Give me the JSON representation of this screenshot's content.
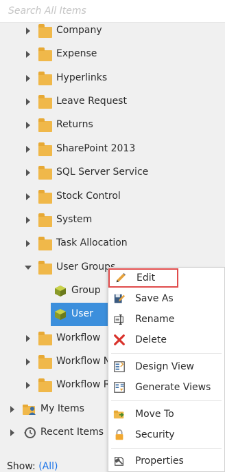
{
  "search": {
    "placeholder": "Search All Items"
  },
  "tree": {
    "folders": [
      {
        "label": "Company"
      },
      {
        "label": "Expense"
      },
      {
        "label": "Hyperlinks"
      },
      {
        "label": "Leave Request"
      },
      {
        "label": "Returns"
      },
      {
        "label": "SharePoint 2013"
      },
      {
        "label": "SQL Server Service"
      },
      {
        "label": "Stock Control"
      },
      {
        "label": "System"
      },
      {
        "label": "Task Allocation"
      },
      {
        "label": "User Groups"
      }
    ],
    "user_groups_children": [
      {
        "label": "Group"
      },
      {
        "label": "User"
      }
    ],
    "workflow_folders": [
      {
        "label": "Workflow"
      },
      {
        "label": "Workflow N"
      },
      {
        "label": "Workflow R"
      }
    ],
    "top_level": [
      {
        "label": "My Items"
      },
      {
        "label": "Recent Items"
      }
    ]
  },
  "context_menu": {
    "items": [
      {
        "label": "Edit",
        "icon": "pencil-icon"
      },
      {
        "label": "Save As",
        "icon": "save-as-icon"
      },
      {
        "label": "Rename",
        "icon": "rename-icon"
      },
      {
        "label": "Delete",
        "icon": "delete-x-icon"
      },
      {
        "label": "Design View",
        "icon": "design-view-icon"
      },
      {
        "label": "Generate Views",
        "icon": "generate-views-icon"
      },
      {
        "label": "Move To",
        "icon": "move-to-folder-icon"
      },
      {
        "label": "Security",
        "icon": "lock-icon"
      },
      {
        "label": "Properties",
        "icon": "properties-icon"
      }
    ]
  },
  "footer": {
    "show_label": "Show:",
    "show_value": "(All)"
  },
  "colors": {
    "selection": "#3c8fdc",
    "folder": "#f0b84a",
    "highlight_border": "#e04b4b",
    "delete_red": "#d9322b",
    "link": "#1a73e8"
  }
}
